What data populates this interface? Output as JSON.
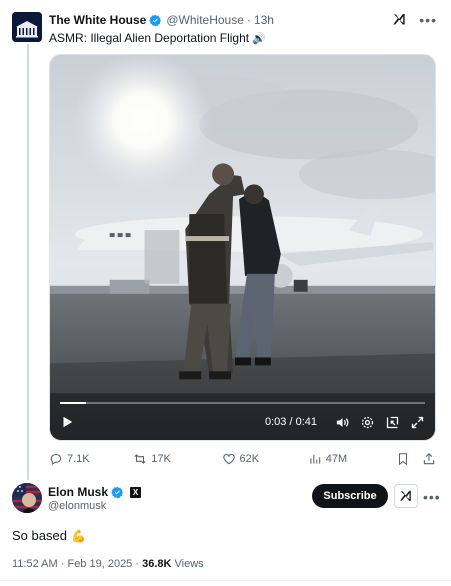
{
  "parent_tweet": {
    "author_name": "The White House",
    "handle": "@WhiteHouse",
    "separator": "·",
    "time_ago": "13h",
    "text": "ASMR: Illegal Alien Deportation Flight",
    "text_icon": "speaker-icon",
    "video": {
      "timecode": "0:03 / 0:41",
      "progress_fraction": 0.07,
      "icons": [
        "play-icon",
        "volume-icon",
        "settings-icon",
        "pip-icon",
        "fullscreen-icon"
      ]
    },
    "metrics": {
      "replies": "7.1K",
      "reposts": "17K",
      "likes": "62K",
      "views": "47M"
    }
  },
  "main_tweet": {
    "author_name": "Elon Musk",
    "handle": "@elonmusk",
    "subscribe_label": "Subscribe",
    "text": "So based",
    "text_emoji": "💪",
    "time": "11:52 AM",
    "date": "Feb 19, 2025",
    "separator": "·",
    "views_count": "36.8K",
    "views_label": "Views"
  },
  "colors": {
    "text_primary": "#0f1419",
    "text_secondary": "#536471",
    "verified_blue": "#1d9bf0",
    "thread_line": "#cfd9de"
  }
}
